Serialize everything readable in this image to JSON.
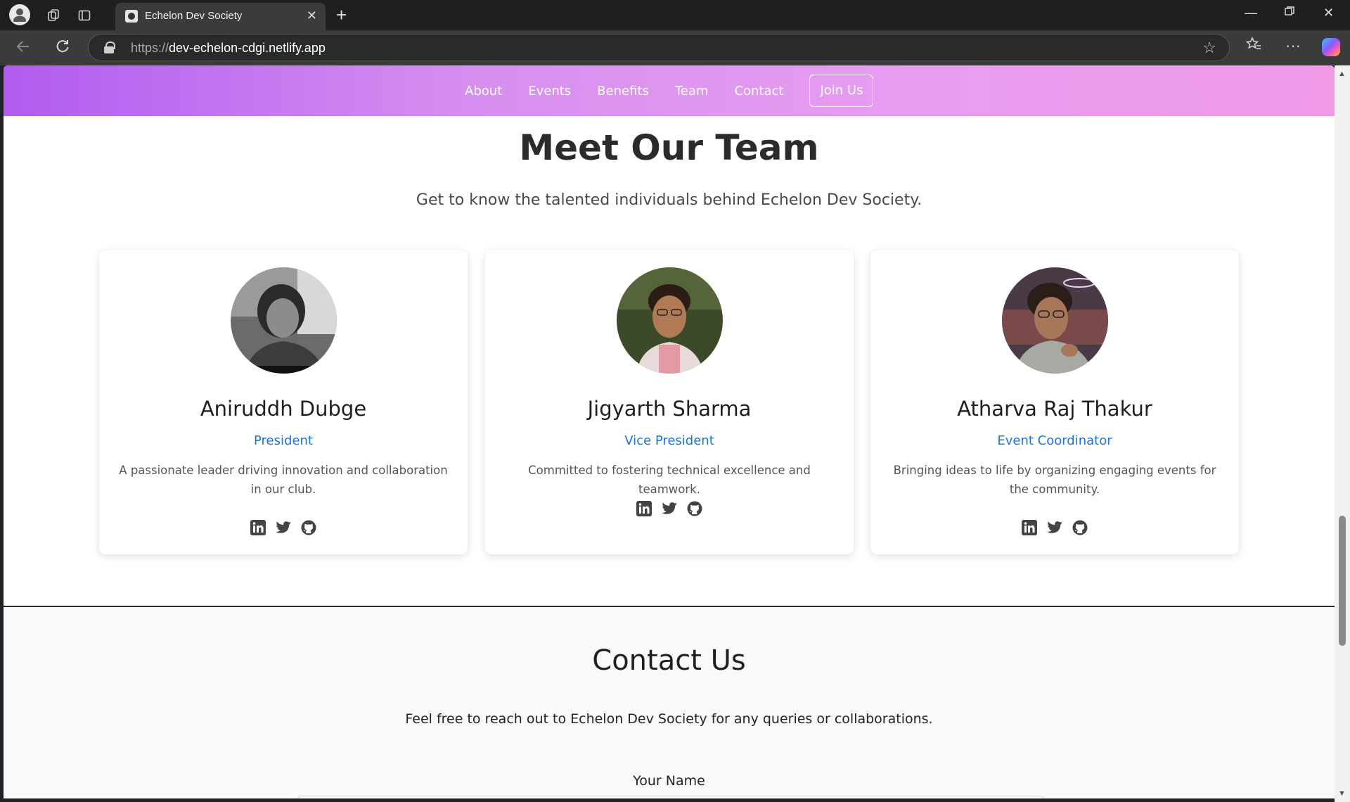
{
  "browser": {
    "tab_title": "Echelon Dev Society",
    "url_protocol": "https://",
    "url_host": "dev-echelon-cdgi.netlify.app"
  },
  "nav": {
    "links": [
      "About",
      "Events",
      "Benefits",
      "Team",
      "Contact"
    ],
    "join_label": "Join Us",
    "gradient_start": "#b05cf0",
    "gradient_end": "#f09ae8"
  },
  "team": {
    "title": "Meet Our Team",
    "subtitle": "Get to know the talented individuals behind Echelon Dev Society.",
    "members": [
      {
        "name": "Aniruddh Dubge",
        "role": "President",
        "description": "A passionate leader driving innovation and collaboration in our club.",
        "socials": [
          "linkedin-icon",
          "twitter-icon",
          "github-icon"
        ]
      },
      {
        "name": "Jigyarth Sharma",
        "role": "Vice President",
        "description": "Committed to fostering technical excellence and teamwork.",
        "socials": [
          "linkedin-icon",
          "twitter-icon",
          "github-icon"
        ]
      },
      {
        "name": "Atharva Raj Thakur",
        "role": "Event Coordinator",
        "description": "Bringing ideas to life by organizing engaging events for the community.",
        "socials": [
          "linkedin-icon",
          "twitter-icon",
          "github-icon"
        ]
      }
    ],
    "role_color": "#1a73d9"
  },
  "contact": {
    "title": "Contact Us",
    "subtitle": "Feel free to reach out to Echelon Dev Society for any queries or collaborations.",
    "name_label": "Your Name"
  }
}
